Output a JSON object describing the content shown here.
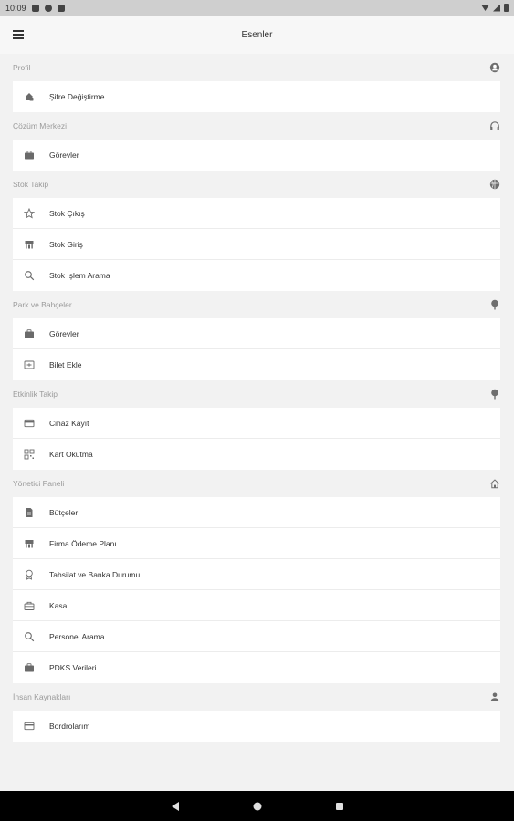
{
  "status_bar": {
    "time": "10:09"
  },
  "app_bar": {
    "title": "Esenler",
    "menu_icon": "hamburger-menu-icon"
  },
  "sections": [
    {
      "title": "Profil",
      "icon": "account-circle-icon",
      "items": [
        {
          "label": "Şifre Değiştirme",
          "icon": "key-lock-icon"
        }
      ]
    },
    {
      "title": "Çözüm Merkezi",
      "icon": "headset-icon",
      "items": [
        {
          "label": "Görevler",
          "icon": "briefcase-icon"
        }
      ]
    },
    {
      "title": "Stok Takip",
      "icon": "globe-icon",
      "items": [
        {
          "label": "Stok Çıkış",
          "icon": "star-outline-icon"
        },
        {
          "label": "Stok Giriş",
          "icon": "store-icon"
        },
        {
          "label": "Stok İşlem Arama",
          "icon": "search-icon"
        }
      ]
    },
    {
      "title": "Park ve Bahçeler",
      "icon": "tree-icon",
      "items": [
        {
          "label": "Görevler",
          "icon": "briefcase-icon"
        },
        {
          "label": "Bilet Ekle",
          "icon": "ticket-icon"
        }
      ]
    },
    {
      "title": "Etkinlik Takip",
      "icon": "tree-icon",
      "items": [
        {
          "label": "Cihaz Kayıt",
          "icon": "credit-card-icon"
        },
        {
          "label": "Kart Okutma",
          "icon": "qr-code-icon"
        }
      ]
    },
    {
      "title": "Yönetici Paneli",
      "icon": "home-icon",
      "items": [
        {
          "label": "Bütçeler",
          "icon": "document-icon"
        },
        {
          "label": "Firma Ödeme Planı",
          "icon": "store-icon"
        },
        {
          "label": "Tahsilat ve Banka Durumu",
          "icon": "badge-icon"
        },
        {
          "label": "Kasa",
          "icon": "toolbox-icon"
        },
        {
          "label": "Personel Arama",
          "icon": "search-icon"
        },
        {
          "label": "PDKS Verileri",
          "icon": "briefcase-icon"
        }
      ]
    },
    {
      "title": "İnsan Kaynakları",
      "icon": "person-icon",
      "items": [
        {
          "label": "Bordrolarım",
          "icon": "credit-card-icon"
        }
      ]
    }
  ],
  "nav_bar": {
    "back_icon": "back-triangle-icon",
    "home_icon": "home-circle-icon",
    "recents_icon": "recents-square-icon"
  }
}
